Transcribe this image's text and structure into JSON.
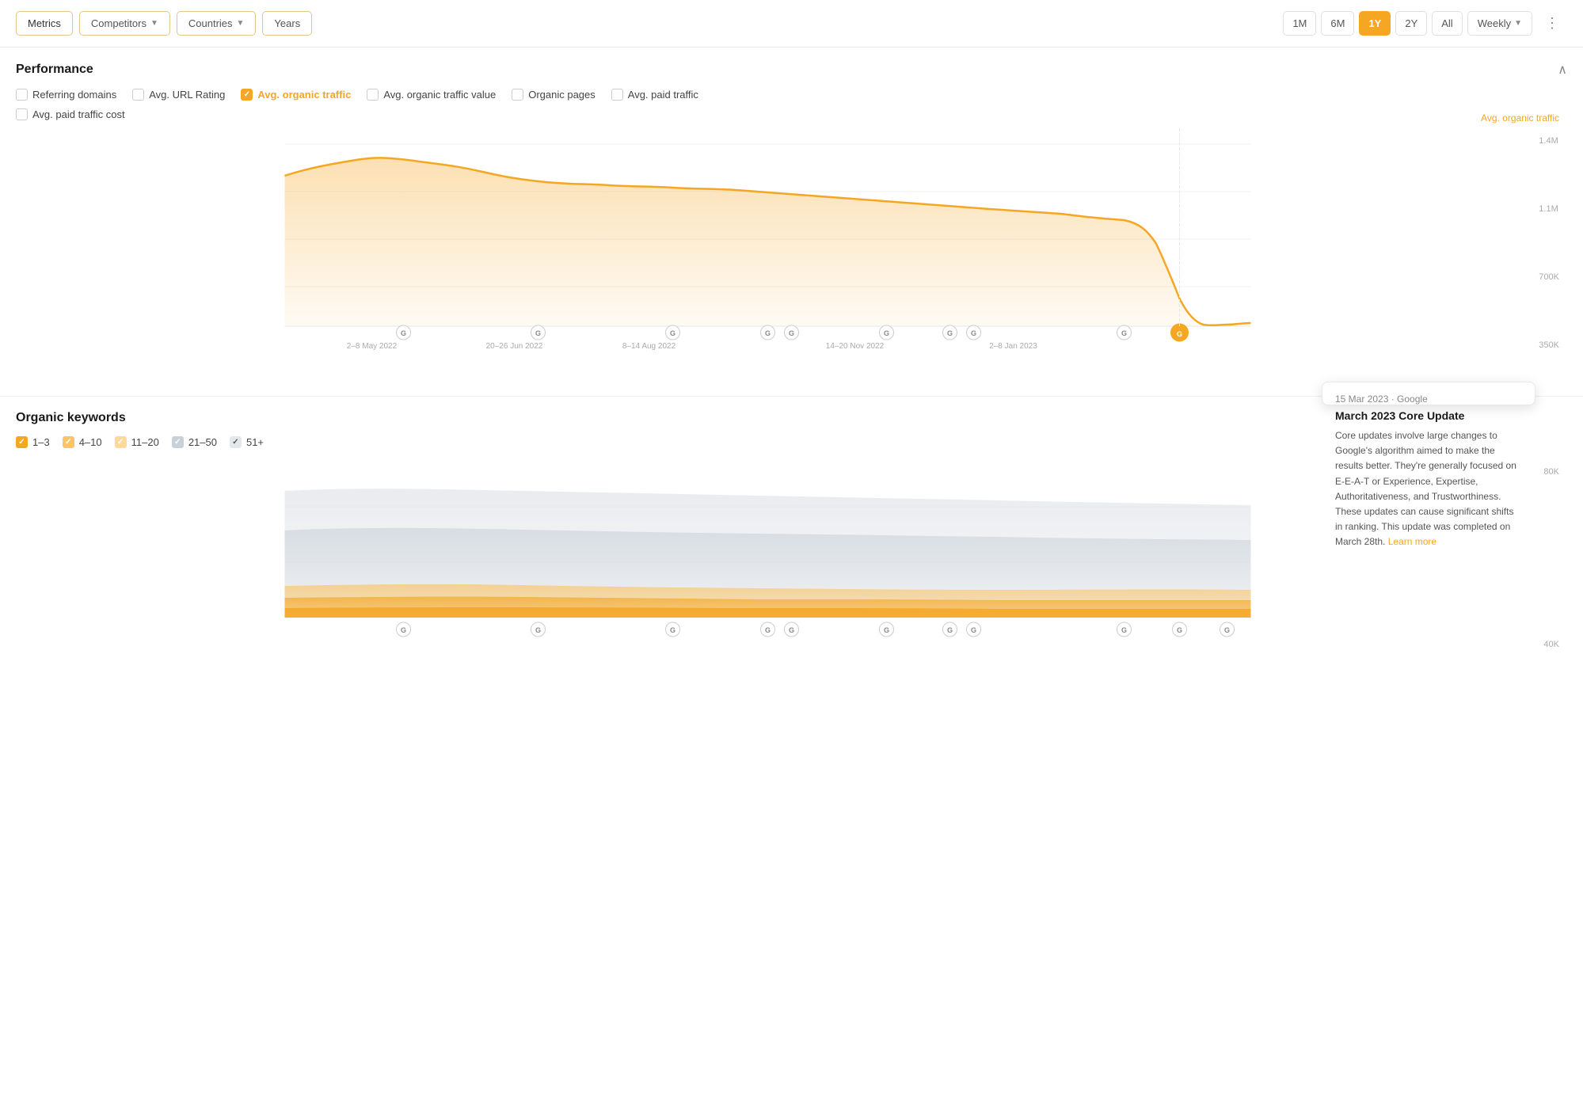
{
  "nav": {
    "tabs": [
      {
        "id": "metrics",
        "label": "Metrics",
        "active": true
      },
      {
        "id": "competitors",
        "label": "Competitors",
        "hasDropdown": true
      },
      {
        "id": "countries",
        "label": "Countries",
        "hasDropdown": true
      },
      {
        "id": "years",
        "label": "Years"
      }
    ],
    "timePeriods": [
      {
        "id": "1m",
        "label": "1M"
      },
      {
        "id": "6m",
        "label": "6M"
      },
      {
        "id": "1y",
        "label": "1Y",
        "active": true
      },
      {
        "id": "2y",
        "label": "2Y"
      },
      {
        "id": "all",
        "label": "All"
      }
    ],
    "interval": "Weekly",
    "moreOptions": "⋮"
  },
  "performance": {
    "title": "Performance",
    "metrics": [
      {
        "id": "referring",
        "label": "Referring domains",
        "checked": false
      },
      {
        "id": "url-rating",
        "label": "Avg. URL Rating",
        "checked": false
      },
      {
        "id": "organic-traffic",
        "label": "Avg. organic traffic",
        "checked": true
      },
      {
        "id": "organic-value",
        "label": "Avg. organic traffic value",
        "checked": false
      },
      {
        "id": "organic-pages",
        "label": "Organic pages",
        "checked": false
      },
      {
        "id": "paid-traffic",
        "label": "Avg. paid traffic",
        "checked": false
      },
      {
        "id": "paid-cost",
        "label": "Avg. paid traffic cost",
        "checked": false
      }
    ],
    "chartLabel": "Avg. organic traffic",
    "yAxisLabels": [
      "1.4M",
      "1.1M",
      "700K",
      "350K"
    ],
    "xAxisLabels": [
      "2–8 May 2022",
      "20–26 Jun 2022",
      "8–14 Aug 2022",
      "14–20 Nov 2022",
      "2–8 Jan 2023"
    ]
  },
  "tooltip": {
    "date": "15 Mar 2023 · Google",
    "title": "March 2023 Core Update",
    "body": "Core updates involve large changes to Google's algorithm aimed to make the results better. They're generally focused on E-E-A-T or Experience, Expertise, Authoritativeness, and Trustworthiness. These updates can cause significant shifts in ranking. This update was completed on March 28th.",
    "linkText": "Learn more"
  },
  "organicKeywords": {
    "title": "Organic keywords",
    "filters": [
      {
        "id": "1-3",
        "label": "1–3",
        "colorClass": "orange",
        "checked": true
      },
      {
        "id": "4-10",
        "label": "4–10",
        "colorClass": "light-orange",
        "checked": true
      },
      {
        "id": "11-20",
        "label": "11–20",
        "colorClass": "lighter-orange",
        "checked": true
      },
      {
        "id": "21-50",
        "label": "21–50",
        "colorClass": "gray",
        "checked": true
      },
      {
        "id": "51plus",
        "label": "51+",
        "colorClass": "light-gray",
        "checked": true
      }
    ],
    "yAxisLabels": [
      "80K",
      "40K"
    ]
  }
}
